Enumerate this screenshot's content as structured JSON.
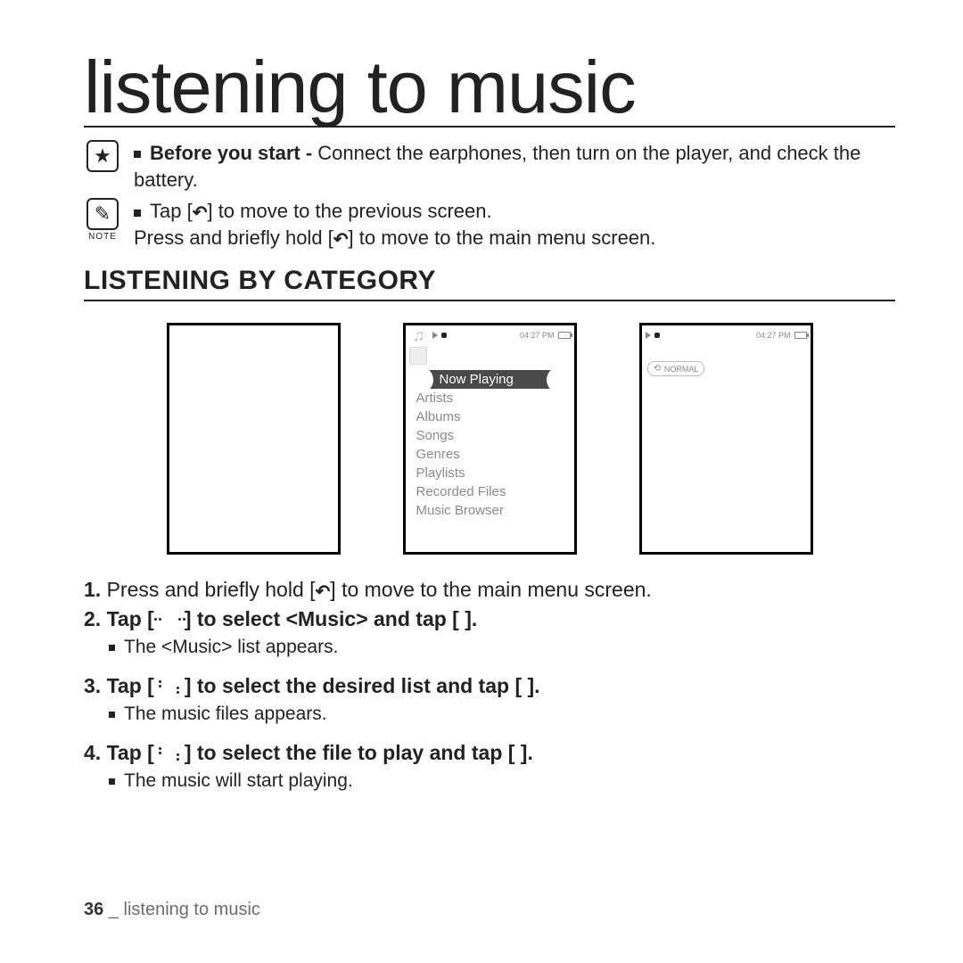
{
  "page_title": "listening to music",
  "intro": {
    "star_before_you_start_bold": "Before you start -",
    "star_before_you_start_rest": " Connect the earphones, then turn on the player, and check the battery.",
    "note_label": "NOTE",
    "note_line1_pre": "Tap [",
    "note_line1_post": "] to move to the previous screen.",
    "note_line2_pre": "Press and briefly hold [",
    "note_line2_post": "] to move to the main menu screen."
  },
  "section_heading": "LISTENING BY CATEGORY",
  "screen2": {
    "status_time": "04:27 PM",
    "menu": [
      "Now Playing",
      "Artists",
      "Albums",
      "Songs",
      "Genres",
      "Playlists",
      "Recorded Files",
      "Music Browser"
    ]
  },
  "screen3": {
    "status_time": "04:27 PM",
    "badge": "NORMAL"
  },
  "steps": {
    "s1_num": "1.",
    "s1_pre": " Press and briefly hold [",
    "s1_post": "] to move to the main menu screen.",
    "s2_num": "2.",
    "s2_pre": " Tap [",
    "s2_mid": "] to select ",
    "s2_music": "<Music>",
    "s2_post": " and tap [      ].",
    "s2_sub": "The <Music> list appears.",
    "s3_num": "3.",
    "s3_pre": " Tap [",
    "s3_post": "] to select the desired list and tap [      ].",
    "s3_sub": "The music files appears.",
    "s4_num": "4.",
    "s4_pre": " Tap [",
    "s4_post": "] to select the file to play and tap [      ].",
    "s4_sub": "The music will start playing."
  },
  "footer": {
    "page_number": "36",
    "sep": " _ ",
    "section": "listening to music"
  }
}
